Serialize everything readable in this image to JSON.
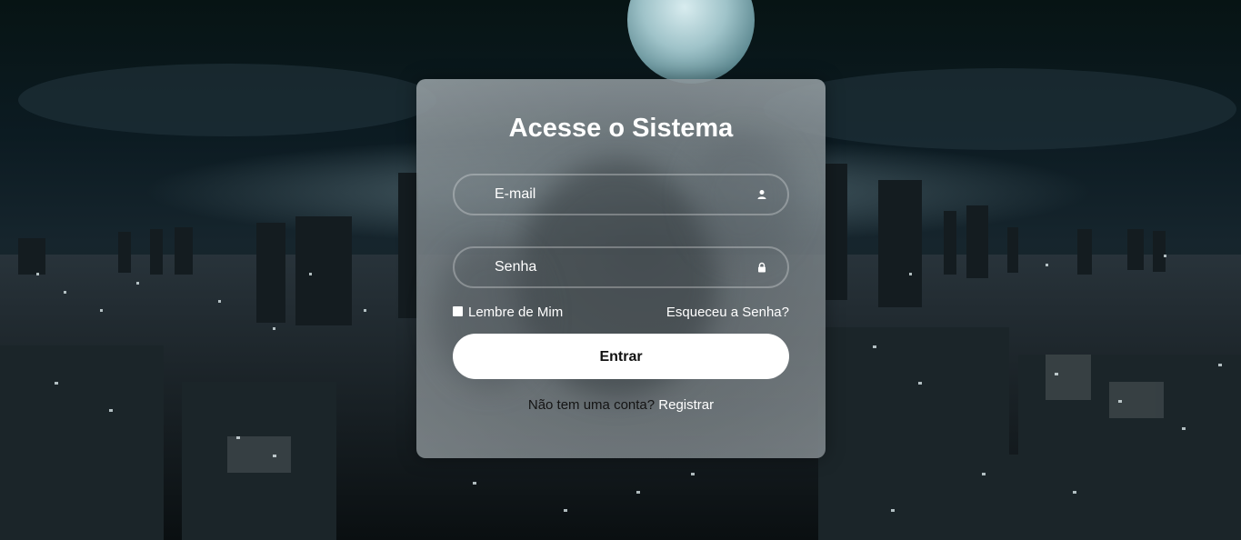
{
  "login": {
    "title": "Acesse o Sistema",
    "email_placeholder": "E-mail",
    "password_placeholder": "Senha",
    "remember_label": "Lembre de Mim",
    "forgot_label": "Esqueceu a Senha?",
    "submit_label": "Entrar",
    "no_account_text": "Não tem uma conta?",
    "register_label": "Registrar"
  },
  "icons": {
    "email": "user-icon",
    "password": "lock-icon"
  },
  "colors": {
    "button_bg": "#ffffff",
    "text": "#ffffff",
    "background": "#0c1b22"
  }
}
